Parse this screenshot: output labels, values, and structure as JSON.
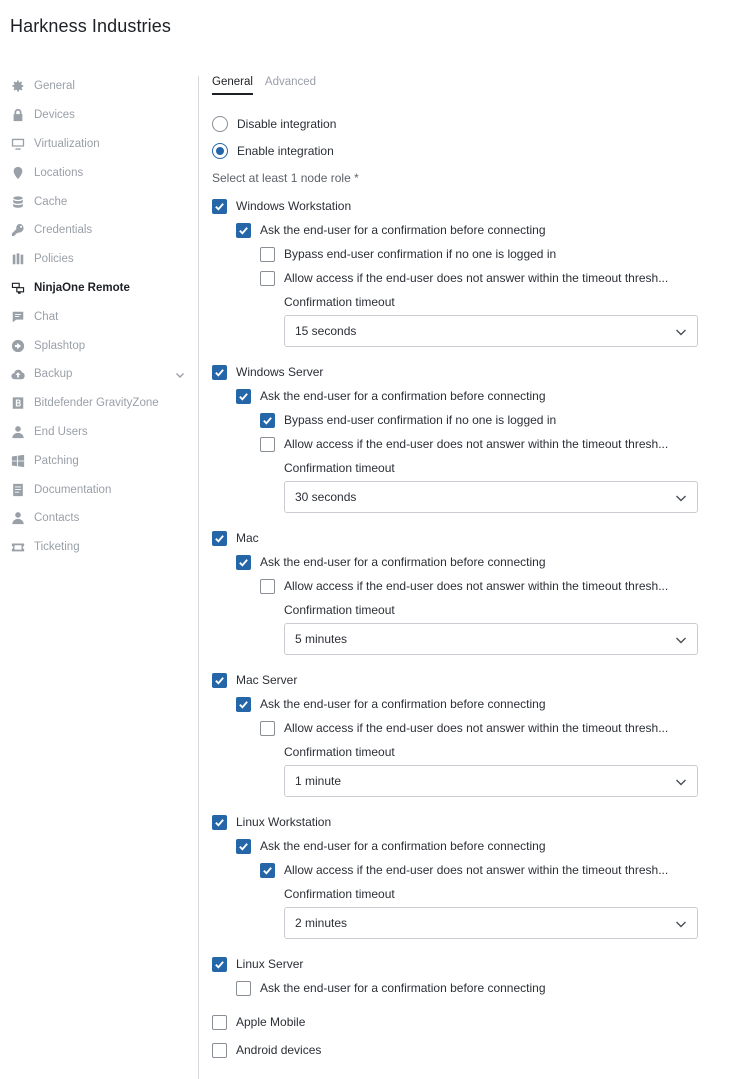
{
  "app_title": "Harkness Industries",
  "sidebar": {
    "items": [
      {
        "label": "General",
        "icon": "gear-icon"
      },
      {
        "label": "Devices",
        "icon": "lock-icon"
      },
      {
        "label": "Virtualization",
        "icon": "monitor-icon"
      },
      {
        "label": "Locations",
        "icon": "location-pin-icon"
      },
      {
        "label": "Cache",
        "icon": "database-icon"
      },
      {
        "label": "Credentials",
        "icon": "key-icon"
      },
      {
        "label": "Policies",
        "icon": "policies-icon"
      },
      {
        "label": "NinjaOne Remote",
        "icon": "remote-screens-icon",
        "active": true
      },
      {
        "label": "Chat",
        "icon": "chat-icon"
      },
      {
        "label": "Splashtop",
        "icon": "splashtop-icon"
      },
      {
        "label": "Backup",
        "icon": "cloud-upload-icon",
        "expandable": true
      },
      {
        "label": "Bitdefender GravityZone",
        "icon": "bitdefender-icon"
      },
      {
        "label": "End Users",
        "icon": "user-icon"
      },
      {
        "label": "Patching",
        "icon": "windows-icon"
      },
      {
        "label": "Documentation",
        "icon": "document-icon"
      },
      {
        "label": "Contacts",
        "icon": "contact-icon"
      },
      {
        "label": "Ticketing",
        "icon": "ticket-icon"
      }
    ]
  },
  "tabs": [
    {
      "label": "General",
      "active": true
    },
    {
      "label": "Advanced",
      "active": false
    }
  ],
  "integration": {
    "disable_label": "Disable integration",
    "enable_label": "Enable integration",
    "selected": "enable",
    "hint": "Select at least 1 node role *"
  },
  "labels": {
    "ask": "Ask the end-user for a confirmation before connecting",
    "bypass": "Bypass end-user confirmation if no one is logged in",
    "allow": "Allow access if the end-user does not answer within the timeout thresh...",
    "timeout": "Confirmation timeout"
  },
  "roles": {
    "windows_workstation": {
      "label": "Windows Workstation",
      "checked": true,
      "ask": true,
      "bypass": false,
      "allow": false,
      "timeout": "15 seconds"
    },
    "windows_server": {
      "label": "Windows Server",
      "checked": true,
      "ask": true,
      "bypass": true,
      "allow": false,
      "timeout": "30 seconds"
    },
    "mac": {
      "label": "Mac",
      "checked": true,
      "ask": true,
      "allow": false,
      "timeout": "5 minutes"
    },
    "mac_server": {
      "label": "Mac Server",
      "checked": true,
      "ask": true,
      "allow": false,
      "timeout": "1 minute"
    },
    "linux_workstation": {
      "label": "Linux Workstation",
      "checked": true,
      "ask": true,
      "allow": true,
      "timeout": "2 minutes"
    },
    "linux_server": {
      "label": "Linux Server",
      "checked": true,
      "ask": false
    },
    "apple_mobile": {
      "label": "Apple Mobile",
      "checked": false
    },
    "android_devices": {
      "label": "Android devices",
      "checked": false
    }
  },
  "colors": {
    "accent": "#2466a8",
    "muted": "#9aa0a8",
    "text": "#2b2f36"
  }
}
